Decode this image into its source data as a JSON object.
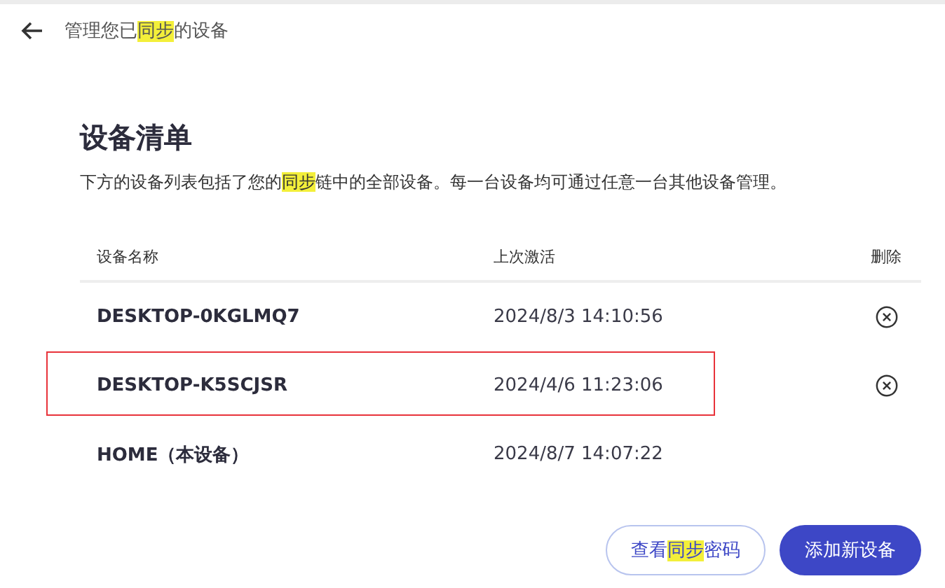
{
  "header": {
    "title": [
      {
        "text": "管理您已",
        "highlighted": false
      },
      {
        "text": "同步",
        "highlighted": true
      },
      {
        "text": "的设备",
        "highlighted": false
      }
    ]
  },
  "heading": "设备清单",
  "description": [
    {
      "text": "下方的设备列表包括了您的",
      "highlighted": false
    },
    {
      "text": "同步",
      "highlighted": true
    },
    {
      "text": "链中的全部设备。每一台设备均可通过任意一台其他设备管理。",
      "highlighted": false
    }
  ],
  "table": {
    "columns": [
      "设备名称",
      "上次激活",
      "删除"
    ],
    "rows": [
      {
        "name": "DESKTOP-0KGLMQ7",
        "last_active": "2024/8/3 14:10:56",
        "removable": true,
        "outlined": false
      },
      {
        "name": "DESKTOP-K5SCJSR",
        "last_active": "2024/4/6 11:23:06",
        "removable": true,
        "outlined": true
      },
      {
        "name": "HOME（本设备）",
        "last_active": "2024/8/7 14:07:22",
        "removable": false,
        "outlined": false
      }
    ]
  },
  "buttons": [
    {
      "kind": "outline",
      "label": [
        {
          "text": "查看",
          "highlighted": false
        },
        {
          "text": "同步",
          "highlighted": true
        },
        {
          "text": "密码",
          "highlighted": false
        }
      ]
    },
    {
      "kind": "primary",
      "label": [
        {
          "text": "添加新设备",
          "highlighted": false
        }
      ]
    }
  ]
}
